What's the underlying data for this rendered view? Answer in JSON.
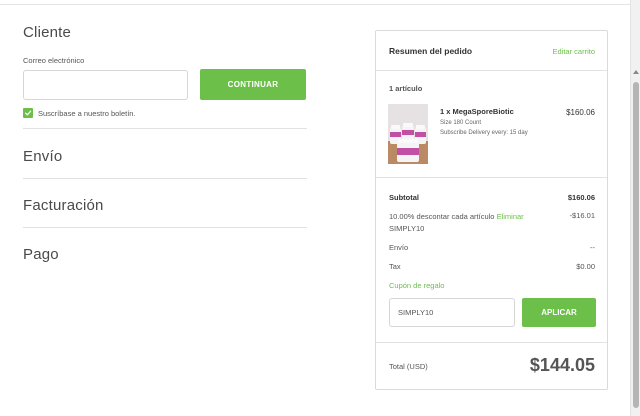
{
  "cliente": {
    "title": "Cliente",
    "email_label": "Correo electrónico",
    "email_value": "",
    "continue_label": "CONTINUAR",
    "subscribe_label": "Suscríbase a nuestro boletín.",
    "subscribe_checked": true
  },
  "sections": {
    "envio": "Envío",
    "facturacion": "Facturación",
    "pago": "Pago"
  },
  "summary": {
    "title": "Resumen del pedido",
    "edit_label": "Editar carrito",
    "items_count": "1 artículo",
    "product": {
      "name": "1 x MegaSporeBiotic",
      "size": "Size 180 Count",
      "subscription": "Subscribe Delivery every: 15 day",
      "price": "$160.06"
    },
    "subtotal_label": "Subtotal",
    "subtotal_value": "$160.06",
    "discount_text": "10.00% descontar cada artículo",
    "discount_remove": "Eliminar",
    "discount_code": "SIMPLY10",
    "discount_value": "-$16.01",
    "shipping_label": "Envío",
    "shipping_value": "--",
    "tax_label": "Tax",
    "tax_value": "$0.00",
    "gift_label": "Cupón de regalo",
    "coupon_value": "SIMPLY10",
    "apply_label": "APLICAR",
    "total_label": "Total (USD)",
    "total_value": "$144.05"
  },
  "colors": {
    "accent": "#6cc04a",
    "text": "#444444",
    "border": "#dadada"
  }
}
